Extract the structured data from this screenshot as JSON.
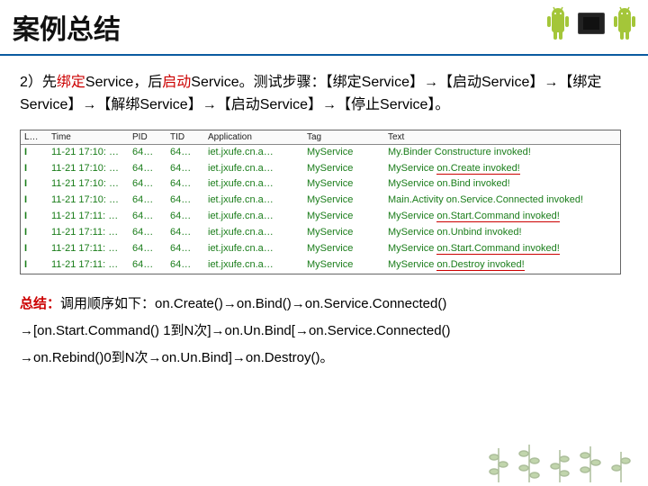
{
  "title": "案例总结",
  "intro": {
    "prefix": "2）先",
    "p1": "绑定",
    "p2": "Service，后",
    "p3": "启动",
    "p4": "Service。测试步骤：【绑定Service】→【启动Service】→【绑定Service】→【解绑Service】→【启动Service】→【停止Service】。"
  },
  "log": {
    "headers": {
      "l": "L…",
      "time": "Time",
      "pid": "PID",
      "tid": "TID",
      "app": "Application",
      "tag": "Tag",
      "text": "Text"
    },
    "common": {
      "level": "I",
      "time_prefix": "11-21 17:1",
      "pid": "64…",
      "tid": "64…",
      "app": "iet.jxufe.cn.a…",
      "tag": "MyService"
    },
    "rows": [
      {
        "time": "11-21 17:10: …",
        "text_a": "My.Binder Constructure invoked!",
        "text_b": "",
        "u": false
      },
      {
        "time": "11-21 17:10: …",
        "text_a": "MyService ",
        "text_b": "on.Create invoked!",
        "u": true
      },
      {
        "time": "11-21 17:10: …",
        "text_a": "MyService on.Bind invoked!",
        "text_b": "",
        "u": false
      },
      {
        "time": "11-21 17:10: …",
        "text_a": "Main.Activity on.Service.Connected invoked!",
        "text_b": "",
        "u": false
      },
      {
        "time": "11-21 17:11: …",
        "text_a": "MyService ",
        "text_b": "on.Start.Command invoked!",
        "u": true
      },
      {
        "time": "11-21 17:11: …",
        "text_a": "MyService on.Unbind invoked!",
        "text_b": "",
        "u": false
      },
      {
        "time": "11-21 17:11: …",
        "text_a": "MyService ",
        "text_b": "on.Start.Command invoked!",
        "u": true
      },
      {
        "time": "11-21 17:11: …",
        "text_a": "MyService ",
        "text_b": "on.Destroy invoked!",
        "u": true
      }
    ]
  },
  "summary": {
    "label": "总结：",
    "line1": "调用顺序如下：on.Create()→on.Bind()→on.Service.Connected()",
    "line2": "→[on.Start.Command() 1到N次]→on.Un.Bind[→on.Service.Connected()",
    "line3": "→on.Rebind()0到N次→on.Un.Bind]→on.Destroy()。"
  }
}
